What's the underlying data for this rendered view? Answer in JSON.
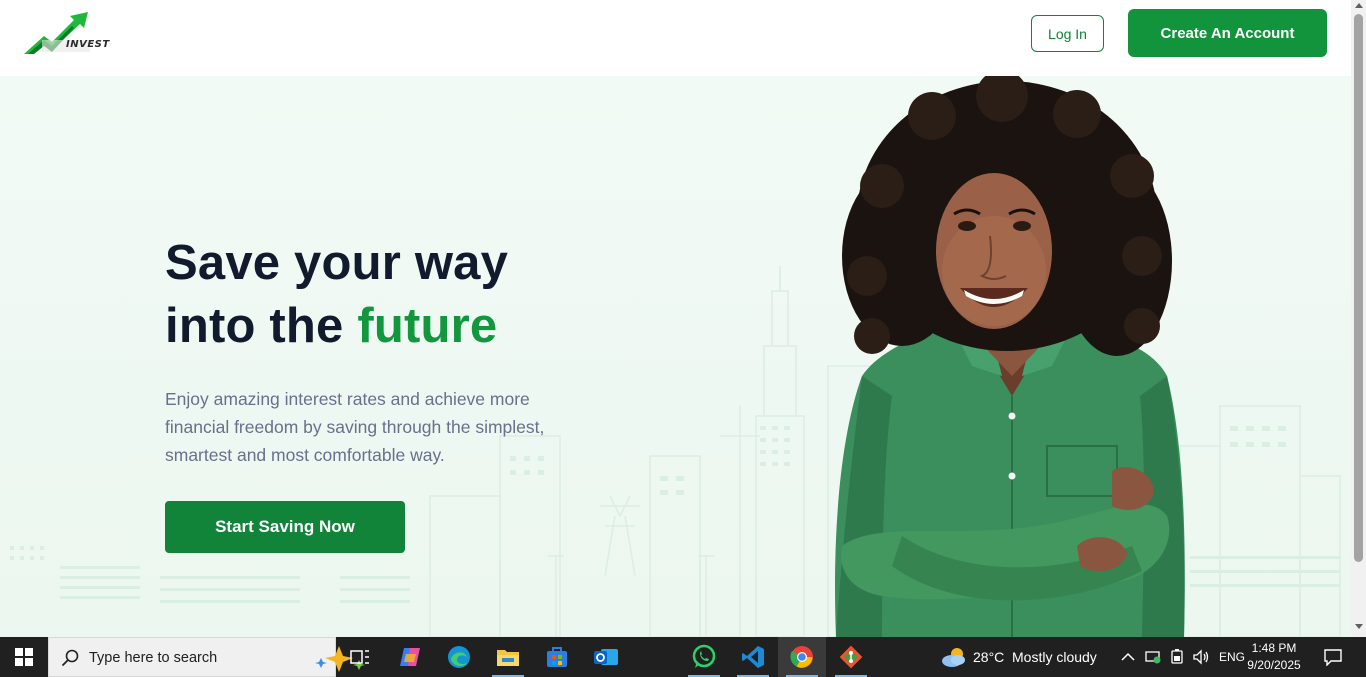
{
  "header": {
    "logo_text": "INVEST",
    "login_label": "Log In",
    "create_label": "Create An Account"
  },
  "hero": {
    "headline_line1": "Save your way",
    "headline_line2_prefix": "into the",
    "headline_accent": "future",
    "subtext": "Enjoy amazing interest rates and achieve more financial freedom by saving through the simplest, smartest and most comfortable way.",
    "cta_label": "Start Saving Now"
  },
  "taskbar": {
    "search_placeholder": "Type here to search",
    "weather_temp": "28°C",
    "weather_desc": "Mostly cloudy",
    "language": "ENG",
    "time": "1:48 PM",
    "date": "9/20/2025"
  },
  "colors": {
    "brand_green": "#11943c",
    "headline_dark": "#121a2e",
    "accent_green": "#12973f",
    "subtext_gray": "#68708a",
    "hero_bg": "#eef8f2",
    "taskbar_bg": "#202020"
  },
  "icons": {
    "logo": "green-growth-arrow-icon",
    "taskbar_apps": [
      "windows-start-icon",
      "search-icon",
      "copilot-sparkle-icon",
      "task-view-icon",
      "copilot-app-icon",
      "edge-icon",
      "file-explorer-icon",
      "microsoft-store-icon",
      "outlook-icon",
      "whatsapp-icon",
      "vscode-icon",
      "chrome-icon",
      "git-icon"
    ],
    "tray": [
      "weather-cloud-icon",
      "chevron-up-icon",
      "network-icon",
      "battery-icon",
      "speaker-icon",
      "notification-icon"
    ]
  }
}
